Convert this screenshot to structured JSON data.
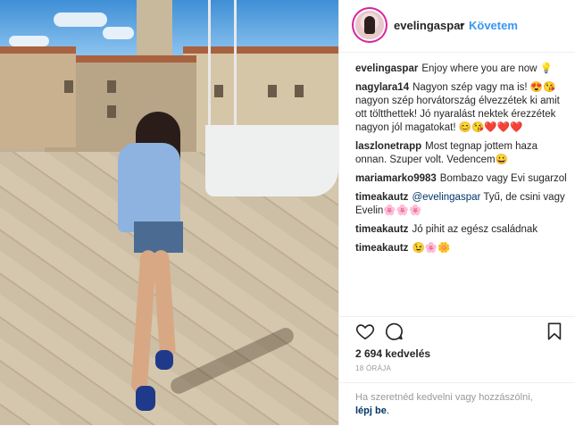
{
  "post": {
    "username": "evelingaspar",
    "separator": "•",
    "follow_label": "Követem"
  },
  "comments": [
    {
      "user": "evelingaspar",
      "text": "Enjoy where you are now 💡"
    },
    {
      "user": "nagylara14",
      "text": "Nagyon szép vagy ma is! 😍😘 nagyon szép horvátország élvezzétek ki amit ott töltthettek! Jó nyaralást nektek érezzétek nagyon jól magatokat! 😊😘❤️❤️❤️"
    },
    {
      "user": "laszlonetrapp",
      "text": "Most tegnap jottem haza onnan. Szuper volt. Vedencem😀"
    },
    {
      "user": "mariamarko9983",
      "text": "Bombazo vagy Evi sugarzol"
    },
    {
      "user": "timeakautz",
      "mention": "@evelingaspar",
      "text": " Tyű, de csini vagy Evelin🌸🌸🌸"
    },
    {
      "user": "timeakautz",
      "text": "Jó pihit az egész családnak"
    },
    {
      "user": "timeakautz",
      "text": "😉🌸🌼"
    }
  ],
  "likes": "2 694 kedvelés",
  "time": "18 ÓRÁJA",
  "footer": {
    "prompt": "Ha szeretnéd kedvelni vagy hozzászólni,",
    "login": "lépj be",
    "period": "."
  },
  "icons": {
    "like": "heart-icon",
    "comment": "comment-icon",
    "save": "bookmark-icon"
  }
}
